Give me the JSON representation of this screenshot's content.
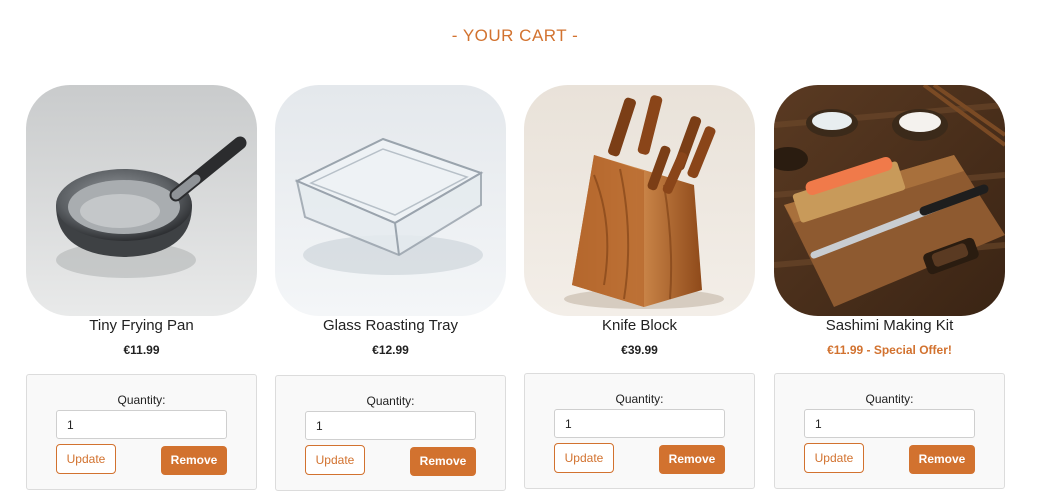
{
  "header": {
    "title": "- YOUR CART -"
  },
  "colors": {
    "accent": "#d2722f",
    "box_bg": "#f9f9f9",
    "text": "#222222"
  },
  "cart": {
    "items": [
      {
        "name": "Tiny Frying Pan",
        "price": "€11.99",
        "image": "frying-pan-image",
        "quantity_label": "Quantity:",
        "quantity_value": "1",
        "update_label": "Update",
        "remove_label": "Remove"
      },
      {
        "name": "Glass Roasting Tray",
        "price": "€12.99",
        "image": "glass-roasting-tray-image",
        "quantity_label": "Quantity:",
        "quantity_value": "1",
        "update_label": "Update",
        "remove_label": "Remove"
      },
      {
        "name": "Knife Block",
        "price": "€39.99",
        "image": "knife-block-image",
        "quantity_label": "Quantity:",
        "quantity_value": "1",
        "update_label": "Update",
        "remove_label": "Remove"
      },
      {
        "name": "Sashimi Making Kit",
        "price": "€11.99 - Special Offer!",
        "image": "sashimi-kit-image",
        "quantity_label": "Quantity:",
        "quantity_value": "1",
        "update_label": "Update",
        "remove_label": "Remove"
      }
    ]
  }
}
